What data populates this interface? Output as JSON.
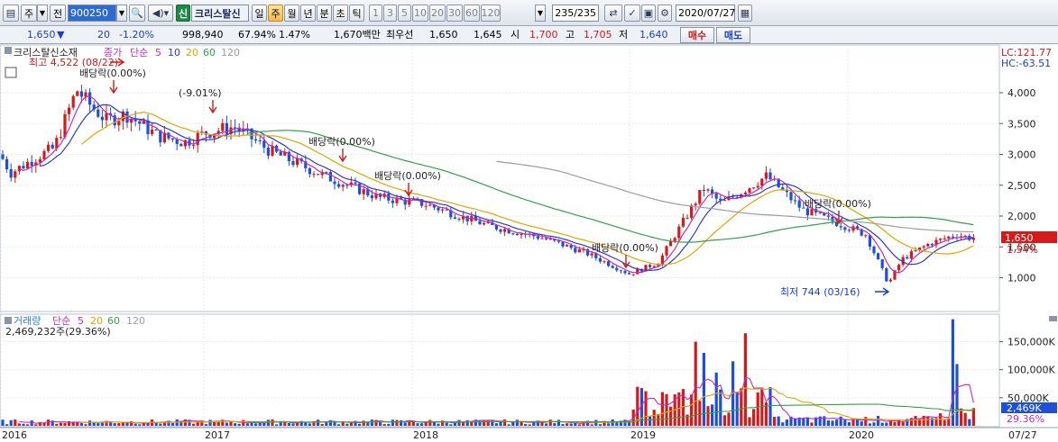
{
  "toolbar": {
    "code_value": "900250",
    "tag_shin": "신",
    "stock_name": "크리스탈신",
    "period_buttons": [
      {
        "label": "일",
        "selected": false
      },
      {
        "label": "주",
        "selected": true
      },
      {
        "label": "월",
        "selected": false
      },
      {
        "label": "년",
        "selected": false
      },
      {
        "label": "분",
        "selected": false
      },
      {
        "label": "초",
        "selected": false
      },
      {
        "label": "틱",
        "selected": false
      }
    ],
    "interval_buttons": [
      "1",
      "3",
      "5",
      "10",
      "20",
      "30",
      "60",
      "120"
    ],
    "count_value": "235/235",
    "date_value": "2020/07/27",
    "left_icons": [
      "chart-layout-icon",
      "order-type-icon",
      "search-icon",
      "speaker-icon"
    ],
    "right_icons": [
      "compare-icon",
      "indicator-icon",
      "save-icon",
      "print-icon",
      "settings-icon"
    ],
    "combo_left_label": "주",
    "combo_left2_label": "전"
  },
  "quote": {
    "price": "1,650",
    "arrow": "▼",
    "change": "20",
    "change_pct": "-1.20%",
    "volume": "998,940",
    "volume_ratio": "67.94%",
    "turnover": "1.47%",
    "amount": "1,670백만",
    "best_label": "최우선",
    "best_ask": "1,650",
    "best_bid": "1,645",
    "open_label": "시",
    "open": "1,700",
    "high_label": "고",
    "high": "1,705",
    "low_label": "저",
    "low": "1,640",
    "buy_label": "매수",
    "sell_label": "매도"
  },
  "chart_data": [
    {
      "type": "candlestick",
      "name": "크리스탈신소재",
      "legend": {
        "price_label": "종가",
        "ma_label": "단순",
        "periods": [
          "5",
          "10",
          "20",
          "60",
          "120"
        ]
      },
      "y_ticks": [
        1000,
        1500,
        2000,
        2500,
        3000,
        3500,
        4000
      ],
      "y_tick_labels": [
        "1,000",
        "1,500",
        "2,000",
        "2,500",
        "3,000",
        "3,500",
        "4,000"
      ],
      "ylim": [
        700,
        4600
      ],
      "x_labels": [
        "2016",
        "2017",
        "2018",
        "2019",
        "2020",
        "07/27"
      ],
      "current_price_label": "1,650",
      "current_pct_label": "1.54%",
      "lc_label": "LC:121.77",
      "hc_label": "HC:-63.51",
      "annotations": [
        {
          "text": "최고 4,522 (08/22)",
          "kind": "high"
        },
        {
          "text": "최저 744 (03/16)",
          "kind": "low"
        },
        {
          "text": "배당락(0.00%)",
          "kind": "dividend"
        },
        {
          "text": "(-9.01%)",
          "kind": "split"
        },
        {
          "text": "배당락(0.00%)",
          "kind": "dividend"
        },
        {
          "text": "배당락(0.00%)",
          "kind": "dividend"
        },
        {
          "text": "배당락(0.00%)",
          "kind": "dividend"
        },
        {
          "text": "배당락(0.00%)",
          "kind": "dividend"
        }
      ],
      "colors": {
        "up": "#d41a1a",
        "down": "#1f4fd6",
        "ma5": "#c12bc1",
        "ma10": "#2c3bc9",
        "ma20": "#e0a500",
        "ma60": "#33a04a",
        "ma120": "#9d9d9d"
      }
    },
    {
      "type": "bar",
      "name": "거래량",
      "legend": {
        "ma_label": "단순",
        "periods": [
          "5",
          "20",
          "60",
          "120"
        ]
      },
      "volume_text": "2,469,232주(29.36%)",
      "y_tick_labels": [
        "150,000K",
        "100,000K",
        "50,000K"
      ],
      "y_ticks": [
        150000,
        100000,
        50000
      ],
      "ylim": [
        0,
        190000
      ],
      "current_label": "2,469K",
      "current_pct_label": "29.36%"
    }
  ]
}
